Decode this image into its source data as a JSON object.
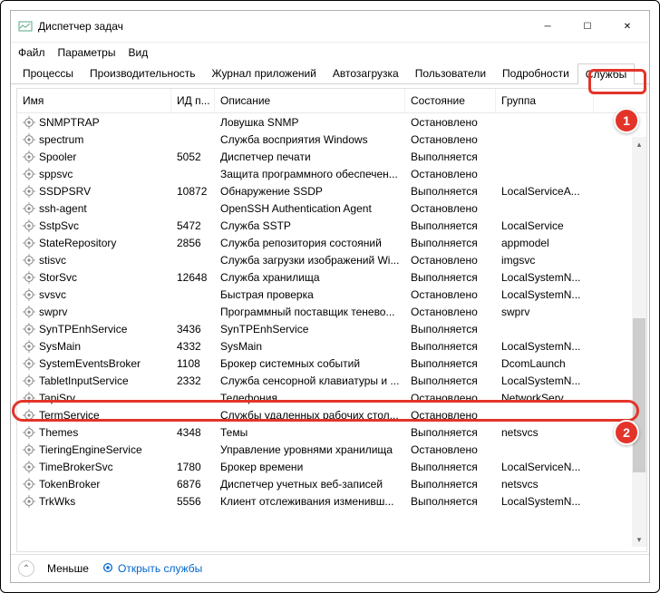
{
  "window": {
    "title": "Диспетчер задач"
  },
  "menu": {
    "file": "Файл",
    "options": "Параметры",
    "view": "Вид"
  },
  "tabs": {
    "processes": "Процессы",
    "performance": "Производительность",
    "app_history": "Журнал приложений",
    "startup": "Автозагрузка",
    "users": "Пользователи",
    "details": "Подробности",
    "services": "Службы"
  },
  "columns": {
    "name": "Имя",
    "pid": "ИД п...",
    "description": "Описание",
    "status": "Состояние",
    "group": "Группа"
  },
  "rows": [
    {
      "name": "SNMPTRAP",
      "pid": "",
      "desc": "Ловушка SNMP",
      "status": "Остановлено",
      "group": ""
    },
    {
      "name": "spectrum",
      "pid": "",
      "desc": "Служба восприятия Windows",
      "status": "Остановлено",
      "group": ""
    },
    {
      "name": "Spooler",
      "pid": "5052",
      "desc": "Диспетчер печати",
      "status": "Выполняется",
      "group": ""
    },
    {
      "name": "sppsvc",
      "pid": "",
      "desc": "Защита программного обеспечен...",
      "status": "Остановлено",
      "group": ""
    },
    {
      "name": "SSDPSRV",
      "pid": "10872",
      "desc": "Обнаружение SSDP",
      "status": "Выполняется",
      "group": "LocalServiceA..."
    },
    {
      "name": "ssh-agent",
      "pid": "",
      "desc": "OpenSSH Authentication Agent",
      "status": "Остановлено",
      "group": ""
    },
    {
      "name": "SstpSvc",
      "pid": "5472",
      "desc": "Служба SSTP",
      "status": "Выполняется",
      "group": "LocalService"
    },
    {
      "name": "StateRepository",
      "pid": "2856",
      "desc": "Служба репозитория состояний",
      "status": "Выполняется",
      "group": "appmodel"
    },
    {
      "name": "stisvc",
      "pid": "",
      "desc": "Служба загрузки изображений Wi...",
      "status": "Остановлено",
      "group": "imgsvc"
    },
    {
      "name": "StorSvc",
      "pid": "12648",
      "desc": "Служба хранилища",
      "status": "Выполняется",
      "group": "LocalSystemN..."
    },
    {
      "name": "svsvc",
      "pid": "",
      "desc": "Быстрая проверка",
      "status": "Остановлено",
      "group": "LocalSystemN..."
    },
    {
      "name": "swprv",
      "pid": "",
      "desc": "Программный поставщик тенево...",
      "status": "Остановлено",
      "group": "swprv"
    },
    {
      "name": "SynTPEnhService",
      "pid": "3436",
      "desc": "SynTPEnhService",
      "status": "Выполняется",
      "group": ""
    },
    {
      "name": "SysMain",
      "pid": "4332",
      "desc": "SysMain",
      "status": "Выполняется",
      "group": "LocalSystemN..."
    },
    {
      "name": "SystemEventsBroker",
      "pid": "1108",
      "desc": "Брокер системных событий",
      "status": "Выполняется",
      "group": "DcomLaunch"
    },
    {
      "name": "TabletInputService",
      "pid": "2332",
      "desc": "Служба сенсорной клавиатуры и ...",
      "status": "Выполняется",
      "group": "LocalSystemN..."
    },
    {
      "name": "TapiSrv",
      "pid": "",
      "desc": "Телефония",
      "status": "Остановлено",
      "group": "NetworkServ..."
    },
    {
      "name": "TermService",
      "pid": "",
      "desc": "Службы удаленных рабочих стол...",
      "status": "Остановлено",
      "group": ""
    },
    {
      "name": "Themes",
      "pid": "4348",
      "desc": "Темы",
      "status": "Выполняется",
      "group": "netsvcs"
    },
    {
      "name": "TieringEngineService",
      "pid": "",
      "desc": "Управление уровнями хранилища",
      "status": "Остановлено",
      "group": ""
    },
    {
      "name": "TimeBrokerSvc",
      "pid": "1780",
      "desc": "Брокер времени",
      "status": "Выполняется",
      "group": "LocalServiceN..."
    },
    {
      "name": "TokenBroker",
      "pid": "6876",
      "desc": "Диспетчер учетных веб-записей",
      "status": "Выполняется",
      "group": "netsvcs"
    },
    {
      "name": "TrkWks",
      "pid": "5556",
      "desc": "Клиент отслеживания изменивш...",
      "status": "Выполняется",
      "group": "LocalSystemN..."
    }
  ],
  "footer": {
    "less": "Меньше",
    "open": "Открыть службы"
  },
  "callouts": {
    "one": "1",
    "two": "2"
  }
}
